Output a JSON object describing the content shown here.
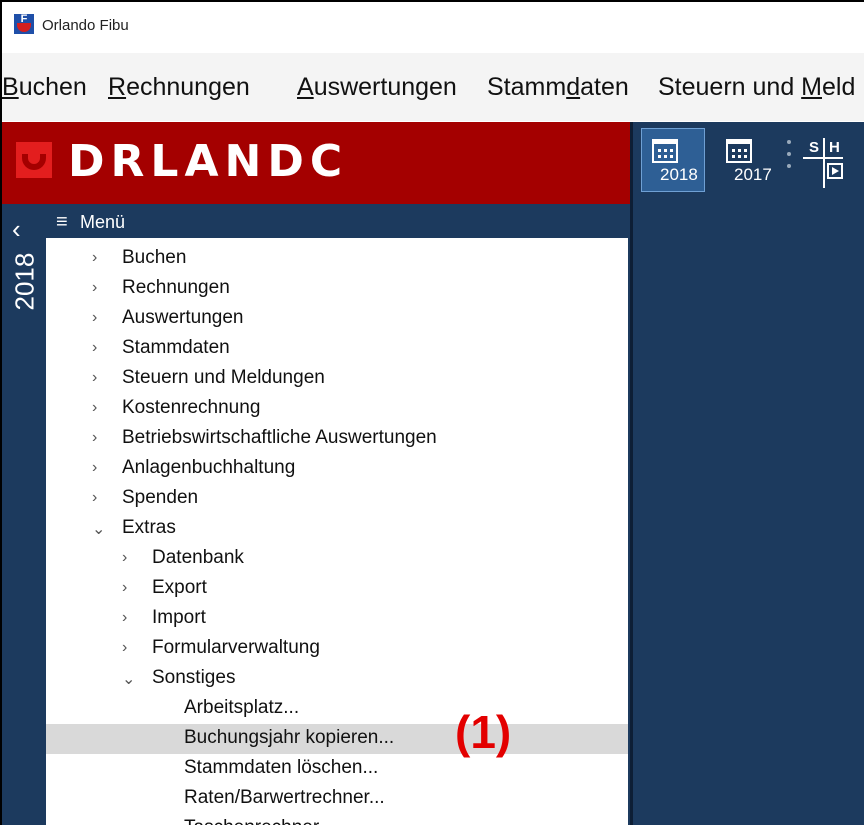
{
  "window": {
    "title": "Orlando Fibu"
  },
  "menubar": {
    "items": [
      {
        "pre": "",
        "ul": "B",
        "post": "uchen"
      },
      {
        "pre": "",
        "ul": "R",
        "post": "echnungen"
      },
      {
        "pre": "",
        "ul": "A",
        "post": "uswertungen"
      },
      {
        "pre": "Stamm",
        "ul": "d",
        "post": "aten"
      },
      {
        "pre": "Steuern und ",
        "ul": "M",
        "post": "eld"
      }
    ]
  },
  "brand": {
    "logo_text": "DRLANDC"
  },
  "toolbar": {
    "buttons": [
      {
        "year": "2018",
        "icon": "calendar-icon",
        "active": true
      },
      {
        "year": "2017",
        "icon": "calendar-icon",
        "active": false
      }
    ],
    "sh_icon": {
      "top": "S|H",
      "icon": "split-document-icon"
    }
  },
  "year_rail": {
    "year": "2018",
    "chevron": "‹"
  },
  "menu": {
    "header": "Menü",
    "items": [
      {
        "label": "Buchen",
        "level": 1,
        "state": "collapsed"
      },
      {
        "label": "Rechnungen",
        "level": 1,
        "state": "collapsed"
      },
      {
        "label": "Auswertungen",
        "level": 1,
        "state": "collapsed"
      },
      {
        "label": "Stammdaten",
        "level": 1,
        "state": "collapsed"
      },
      {
        "label": "Steuern und Meldungen",
        "level": 1,
        "state": "collapsed"
      },
      {
        "label": "Kostenrechnung",
        "level": 1,
        "state": "collapsed"
      },
      {
        "label": "Betriebswirtschaftliche Auswertungen",
        "level": 1,
        "state": "collapsed"
      },
      {
        "label": "Anlagenbuchhaltung",
        "level": 1,
        "state": "collapsed"
      },
      {
        "label": "Spenden",
        "level": 1,
        "state": "collapsed"
      },
      {
        "label": "Extras",
        "level": 1,
        "state": "expanded"
      },
      {
        "label": "Datenbank",
        "level": 2,
        "state": "collapsed"
      },
      {
        "label": "Export",
        "level": 2,
        "state": "collapsed"
      },
      {
        "label": "Import",
        "level": 2,
        "state": "collapsed"
      },
      {
        "label": "Formularverwaltung",
        "level": 2,
        "state": "collapsed"
      },
      {
        "label": "Sonstiges",
        "level": 2,
        "state": "expanded"
      },
      {
        "label": "Arbeitsplatz...",
        "level": 3,
        "state": "leaf"
      },
      {
        "label": "Buchungsjahr kopieren...",
        "level": 3,
        "state": "leaf",
        "highlighted": true
      },
      {
        "label": "Stammdaten löschen...",
        "level": 3,
        "state": "leaf"
      },
      {
        "label": "Raten/Barwertrechner...",
        "level": 3,
        "state": "leaf"
      },
      {
        "label": "Taschenrechner...",
        "level": 3,
        "state": "leaf"
      }
    ]
  },
  "annotation": {
    "text": "(1)",
    "color": "#e30000"
  },
  "colors": {
    "brand_red": "#a40000",
    "navy": "#1c3a5e",
    "highlight": "#d9d9d9"
  }
}
